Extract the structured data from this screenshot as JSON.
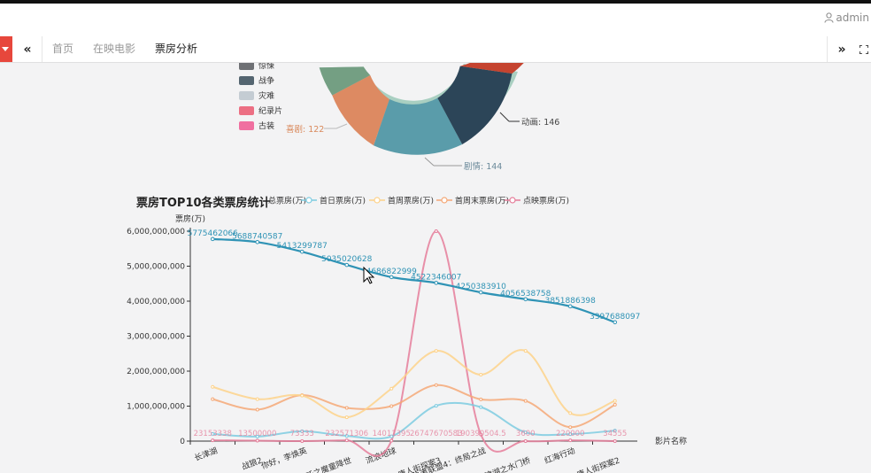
{
  "header": {
    "username": "admin"
  },
  "tabbar": {
    "tabs": [
      {
        "label": "首页"
      },
      {
        "label": "在映电影"
      },
      {
        "label": "票房分析",
        "active": true
      }
    ]
  },
  "pie_chart": {
    "legend": [
      {
        "label": "惊悚",
        "color": "#6e7074"
      },
      {
        "label": "战争",
        "color": "#546570"
      },
      {
        "label": "灾难",
        "color": "#c4ccd3"
      },
      {
        "label": "纪录片",
        "color": "#ec6f83"
      },
      {
        "label": "古装",
        "color": "#f06fa0"
      }
    ],
    "labels": [
      {
        "text": "动画: 146",
        "color": "#444"
      },
      {
        "text": "剧情: 144",
        "color": "#6b8a9a"
      },
      {
        "text": "喜剧: 122",
        "color": "#d9895c"
      }
    ]
  },
  "chart_data": {
    "type": "line",
    "title": "票房TOP10各类票房统计",
    "ylabel": "票房(万)",
    "xlabel": "影片名称",
    "ylim": [
      0,
      6000000000
    ],
    "yticks": [
      "6,000,000,000",
      "5,000,000,000",
      "4,000,000,000",
      "3,000,000,000",
      "2,000,000,000",
      "1,000,000,000",
      "0"
    ],
    "categories": [
      "长津湖",
      "战狼2",
      "你好，李焕英",
      "哪吒之魔童降世",
      "流浪地球",
      "唐人街探案3",
      "复仇者联盟4：终局之战",
      "长津湖之水门桥",
      "红海行动",
      "唐人街探案2"
    ],
    "legend": [
      "总票房(万)",
      "首日票房(万)",
      "首周票房(万)",
      "首周末票房(万)",
      "点映票房(万)"
    ],
    "colors": {
      "total": "#2f93b5",
      "first_day": "#7ccbe0",
      "first_week": "#fdd28a",
      "first_weekend": "#f4a877",
      "preview": "#e57d9a"
    },
    "series": [
      {
        "name": "总票房(万)",
        "values": [
          5775462066,
          5688740587,
          5413299787,
          5035020628,
          4686822999,
          4522346007,
          4250383910,
          4056538758,
          3851886398,
          3397688097
        ]
      },
      {
        "name": "首日票房(万)",
        "values": [
          206191305.4,
          130000000,
          281293737.72,
          150000000,
          135000000,
          1010000000,
          971772168,
          250000000,
          200000000,
          300000000
        ]
      },
      {
        "name": "首周票房(万)",
        "values": [
          1550000000,
          1200000000,
          1300000000,
          680000000,
          1500000000,
          2578770804.57,
          1900000000,
          2580000000,
          800000000,
          1150000000
        ]
      },
      {
        "name": "首周末票房(万)",
        "values": [
          1200000000,
          900000000,
          1313521628.74,
          950000000,
          1000000000,
          1600000000,
          1193003558.25,
          1150000000,
          400000000,
          1040000000
        ]
      },
      {
        "name": "点映票房(万)",
        "values": [
          23153338,
          13500000,
          73333,
          23257130,
          14011395,
          26747670583,
          190390504.5,
          3600,
          22000000,
          34555
        ]
      }
    ],
    "labels": {
      "total": [
        "5775462066",
        "5688740587",
        "5413299787",
        "5035020628",
        "4686822999",
        "4522346007",
        "4250383910",
        "4056538758",
        "3851886398",
        "3397688097"
      ],
      "bottom": [
        "23153338",
        "13500000",
        "73333",
        "232571306",
        "14011395",
        "26747670583",
        "190390504.5",
        "3600",
        "220000",
        "34555"
      ]
    }
  }
}
